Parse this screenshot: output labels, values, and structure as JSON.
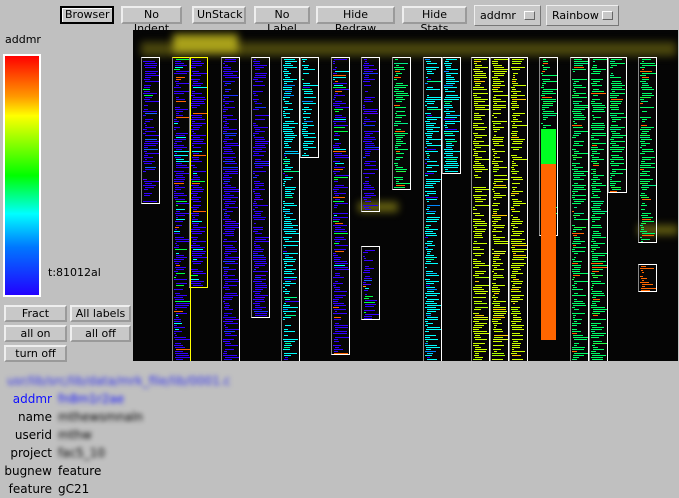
{
  "toolbar": {
    "buttons": [
      "Browser",
      "No Indent",
      "UnStack",
      "No Label",
      "Hide Redraw",
      "Hide Stats"
    ],
    "attribute_menu": "addmr",
    "colormap_menu": "Rainbow"
  },
  "colorbar": {
    "title": "addmr",
    "min_label": "t:81012al",
    "colormap": "rainbow"
  },
  "panel_buttons": {
    "fract": "Fract",
    "all_labels": "All labels",
    "all_on": "all on",
    "all_off": "all off",
    "turn_off": "turn off"
  },
  "info": {
    "path": "usr/lib/src/lib/data/mrk_file/lib/0001.c",
    "rows": [
      {
        "key": "addmr",
        "value": "fn8m1r2ae",
        "highlight": true,
        "blurred": true
      },
      {
        "key": "name",
        "value": "mthewsmnaln",
        "blurred": true
      },
      {
        "key": "userid",
        "value": "mthw",
        "blurred": true
      },
      {
        "key": "project",
        "value": "fac5_10",
        "blurred": true
      },
      {
        "key": "bugnew",
        "value": "feature",
        "blurred": false
      },
      {
        "key": "feature",
        "value": "gC21",
        "blurred": false
      }
    ]
  },
  "colors": {
    "highlight_text": "#1010ff",
    "selected_border": "#ffff00",
    "file_border": "#ffffff",
    "background": "#050505"
  }
}
